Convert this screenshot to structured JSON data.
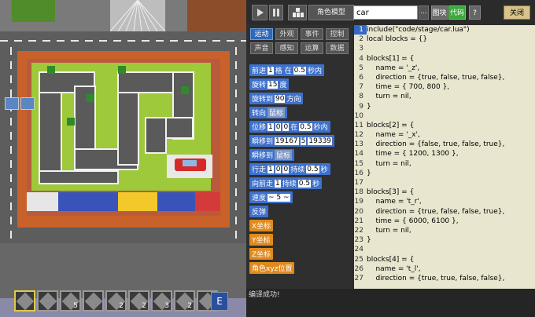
{
  "toolbar": {
    "play_icon": "play-icon",
    "pause_icon": "pause-icon",
    "char_icon": "character-icon",
    "char_model_label": "角色模型",
    "search_value": "car",
    "more_label": "...",
    "block_tab_label": "图块",
    "code_tab_label": "代码",
    "help_label": "?",
    "close_label": "关闭"
  },
  "categories": [
    {
      "label": "运动",
      "active": true
    },
    {
      "label": "外观"
    },
    {
      "label": "事件"
    },
    {
      "label": "控制"
    },
    {
      "label": "声音"
    },
    {
      "label": "感知"
    },
    {
      "label": "运算"
    },
    {
      "label": "数据"
    }
  ],
  "blocks": [
    {
      "parts": [
        "前进",
        "1",
        "格 在",
        "0.5",
        "秒内"
      ]
    },
    {
      "parts": [
        "旋转",
        "15",
        "度"
      ]
    },
    {
      "parts": [
        "旋转到",
        "90",
        "方向"
      ]
    },
    {
      "parts": [
        "转向",
        "鼠标"
      ]
    },
    {
      "parts": [
        "位移",
        "1",
        "0",
        "0",
        "在",
        "0.5",
        "秒内"
      ]
    },
    {
      "parts": [
        "瞬移到",
        "19167",
        "5",
        "19339"
      ]
    },
    {
      "parts": [
        "瞬移到",
        "鼠标"
      ]
    },
    {
      "parts": [
        "行走",
        "1",
        "0",
        "0",
        "持续",
        "0.5",
        "秒"
      ]
    },
    {
      "parts": [
        "向前走",
        "1",
        "持续",
        "0.5",
        "秒"
      ]
    },
    {
      "parts": [
        "速度",
        "~ 5 ~"
      ]
    },
    {
      "parts": [
        "反弹"
      ]
    },
    {
      "parts": [
        "X坐标"
      ],
      "orange": true
    },
    {
      "parts": [
        "Y坐标"
      ],
      "orange": true
    },
    {
      "parts": [
        "Z坐标"
      ],
      "orange": true
    },
    {
      "parts": [
        "角色xyz位置"
      ],
      "orange": true
    }
  ],
  "code_lines": [
    "include(\"code/stage/car.lua\")",
    "local blocks = {}",
    "",
    "blocks[1] = {",
    "    name = '_z',",
    "    direction = {true, false, true, false},",
    "    time = { 700, 800 },",
    "    turn = nil,",
    "}",
    "",
    "blocks[2] = {",
    "    name = '_x',",
    "    direction = {false, true, false, true},",
    "    time = { 1200, 1300 },",
    "    turn = nil,",
    "}",
    "",
    "blocks[3] = {",
    "    name = 't_r',",
    "    direction = {true, false, false, true},",
    "    time = { 6000, 6100 },",
    "    turn = nil,",
    "}",
    "",
    "blocks[4] = {",
    "    name = 't_l',",
    "    direction = {true, true, false, false},"
  ],
  "status": {
    "message": "编译成功!"
  },
  "hotbar": [
    {
      "count": "",
      "active": true
    },
    {
      "count": ""
    },
    {
      "count": "5"
    },
    {
      "count": ""
    },
    {
      "count": "2"
    },
    {
      "count": "2"
    },
    {
      "count": "3"
    },
    {
      "count": "2"
    },
    {
      "count": "6"
    }
  ],
  "hotbar_key": "E",
  "colors": {
    "accent_blue": "#3e71cc",
    "accent_green": "#3aa83a",
    "code_bg": "#e9e6cf",
    "orange_block": "#e08a1e"
  }
}
